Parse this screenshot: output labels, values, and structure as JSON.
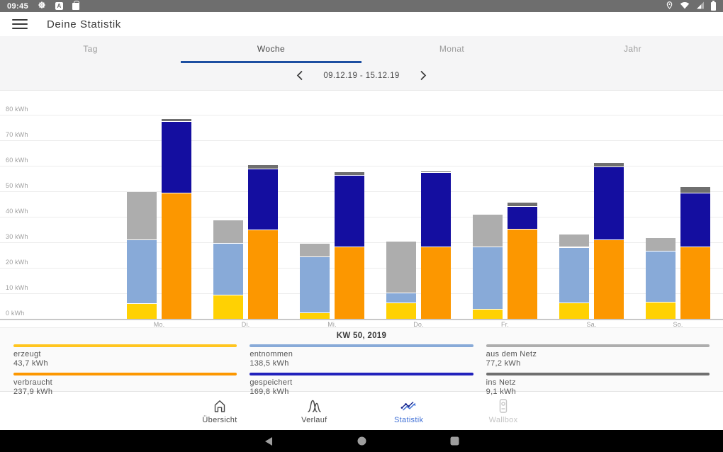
{
  "status_bar": {
    "time": "09:45"
  },
  "app_bar": {
    "title": "Deine Statistik"
  },
  "tabs": {
    "items": [
      {
        "label": "Tag"
      },
      {
        "label": "Woche"
      },
      {
        "label": "Monat"
      },
      {
        "label": "Jahr"
      }
    ],
    "active_index": 1,
    "underline_color": "#1D4FA1"
  },
  "date_nav": {
    "range": "09.12.19 - 15.12.19"
  },
  "chart_data": {
    "type": "bar",
    "subtype": "grouped-stacked-pairs",
    "unit": "kWh",
    "categories": [
      "Mo.",
      "Di.",
      "Mi.",
      "Do.",
      "Fr.",
      "Sa.",
      "So."
    ],
    "ylim": [
      0,
      80
    ],
    "yticks": [
      "0 kWh",
      "10 kWh",
      "20 kWh",
      "30 kWh",
      "40 kWh",
      "50 kWh",
      "60 kWh",
      "70 kWh",
      "80 kWh"
    ],
    "grid": true,
    "series_left": [
      {
        "name": "erzeugt",
        "color": "#FFD103",
        "values": [
          6.0,
          9.4,
          2.6,
          6.5,
          3.9,
          6.5,
          6.8
        ]
      },
      {
        "name": "entnommen",
        "color": "#88AAD8",
        "values": [
          25.0,
          20.4,
          21.8,
          3.9,
          24.5,
          21.7,
          19.8
        ]
      },
      {
        "name": "aus dem Netz",
        "color": "#ADADAD",
        "values": [
          19.0,
          9.1,
          5.2,
          20.2,
          12.6,
          5.1,
          5.3
        ]
      }
    ],
    "series_right": [
      {
        "name": "verbraucht",
        "color": "#FC9700",
        "values": [
          49.4,
          34.9,
          28.2,
          28.2,
          35.4,
          31.0,
          28.4
        ]
      },
      {
        "name": "gespeichert",
        "color": "#140EA0",
        "values": [
          28.2,
          23.9,
          28.3,
          29.2,
          8.8,
          28.7,
          21.1
        ]
      },
      {
        "name": "ins Netz",
        "color": "#6F6F6F",
        "values": [
          0.9,
          1.8,
          1.2,
          0.3,
          1.6,
          1.7,
          2.5
        ]
      }
    ]
  },
  "legend": {
    "title": "KW 50, 2019",
    "entries": [
      {
        "label": "erzeugt",
        "value": "43,7 kWh",
        "color": "#FFC51F"
      },
      {
        "label": "entnommen",
        "value": "138,5 kWh",
        "color": "#88AAD8"
      },
      {
        "label": "aus dem Netz",
        "value": "77,2 kWh",
        "color": "#ADADAD"
      },
      {
        "label": "verbraucht",
        "value": "237,9 kWh",
        "color": "#FC9700"
      },
      {
        "label": "gespeichert",
        "value": "169,8 kWh",
        "color": "#2121BC"
      },
      {
        "label": "ins Netz",
        "value": "9,1 kWh",
        "color": "#6F6F6F"
      }
    ]
  },
  "bottom_nav": {
    "active_color": "#4272D6",
    "items": [
      {
        "label": "Übersicht",
        "icon": "home-icon",
        "name": "nav-item-uebersicht",
        "state": "default"
      },
      {
        "label": "Verlauf",
        "icon": "history-curves-icon",
        "name": "nav-item-verlauf",
        "state": "default"
      },
      {
        "label": "Statistik",
        "icon": "statistics-trend-icon",
        "name": "nav-item-statistik",
        "state": "active"
      },
      {
        "label": "Wallbox",
        "icon": "wallbox-icon",
        "name": "nav-item-wallbox",
        "state": "disabled"
      }
    ]
  }
}
